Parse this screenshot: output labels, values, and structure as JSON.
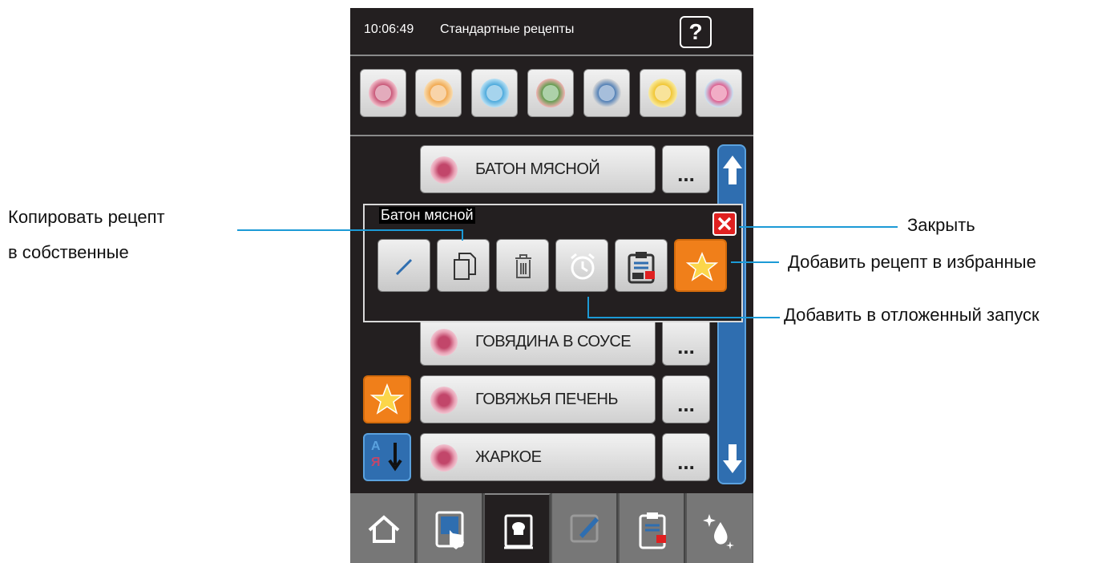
{
  "header": {
    "time": "10:06:49",
    "title": "Стандартные рецепты",
    "help_label": "?"
  },
  "categories": [
    {
      "icon": "meat-icon",
      "color": "#c2466a"
    },
    {
      "icon": "poultry-icon",
      "color": "#f0a040"
    },
    {
      "icon": "fish-icon",
      "color": "#3aa0d8"
    },
    {
      "icon": "vegetables-icon",
      "color": "#4a9a40"
    },
    {
      "icon": "side-dish-icon",
      "color": "#3a70b0"
    },
    {
      "icon": "bakery-icon",
      "color": "#f0c020"
    },
    {
      "icon": "dessert-icon",
      "color": "#e04a80"
    }
  ],
  "recipes": [
    {
      "name": "БАТОН МЯСНОЙ",
      "more": "..."
    },
    {
      "name": "ГОВЯДИНА В СОУСЕ",
      "more": "..."
    },
    {
      "name": "ГОВЯЖЬЯ ПЕЧЕНЬ",
      "more": "..."
    },
    {
      "name": "ЖАРКОЕ",
      "more": "..."
    }
  ],
  "sort_label": {
    "top": "А",
    "bottom": "Я"
  },
  "dialog": {
    "title": "Батон мясной",
    "actions": [
      "edit-icon",
      "copy-icon",
      "delete-icon",
      "alarm-clock-icon",
      "clipboard-icon",
      "star-icon"
    ]
  },
  "tabs": [
    "home-icon",
    "touch-tablet-icon",
    "cookbook-icon",
    "edit-note-icon",
    "schedule-clipboard-icon",
    "cleaning-icon"
  ],
  "callouts": {
    "copy_line1": "Копировать рецепт",
    "copy_line2": "в собственные",
    "close": "Закрыть",
    "favorite": "Добавить рецепт в избранные",
    "delayed": "Добавить в отложенный запуск"
  },
  "colors": {
    "accent_blue": "#1c9ad6",
    "favorite_orange": "#f07f1a",
    "close_red": "#e02020"
  }
}
